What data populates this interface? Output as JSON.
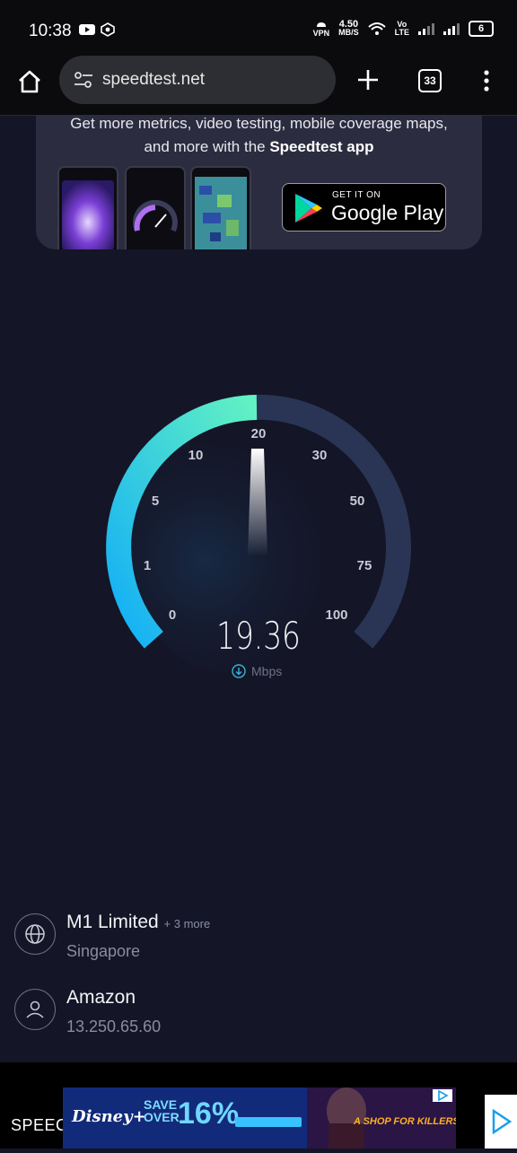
{
  "status_bar": {
    "time": "10:38",
    "net_speed_value": "4.50",
    "net_speed_unit": "MB/S",
    "vpn_label": "VPN",
    "volte_top": "Vo",
    "volte_bottom": "LTE",
    "battery": "6"
  },
  "browser": {
    "url": "speedtest.net",
    "tab_count": "33"
  },
  "promo": {
    "line1": "Get more metrics, video testing, mobile coverage maps,",
    "line2_prefix": "and more with the ",
    "line2_bold": "Speedtest app",
    "store_small": "GET IT ON",
    "store_main": "Google Play"
  },
  "gauge": {
    "ticks": [
      "0",
      "1",
      "5",
      "10",
      "20",
      "30",
      "50",
      "75",
      "100"
    ],
    "value": "19.36",
    "unit": "Mbps",
    "colors": {
      "track": "#2a3555",
      "fill_start": "#17b8f5",
      "fill_end": "#5ef0c2"
    }
  },
  "connection": {
    "isp_name": "M1 Limited",
    "isp_more": "+ 3 more",
    "isp_location": "Singapore",
    "host_name": "Amazon",
    "host_ip": "13.250.65.60"
  },
  "ad": {
    "brand_text": "SPEEC",
    "disney": "Disney+",
    "save_1": "SAVE",
    "save_2": "OVER",
    "percent": "16%",
    "headline": "A SHOP FOR KILLERS"
  }
}
